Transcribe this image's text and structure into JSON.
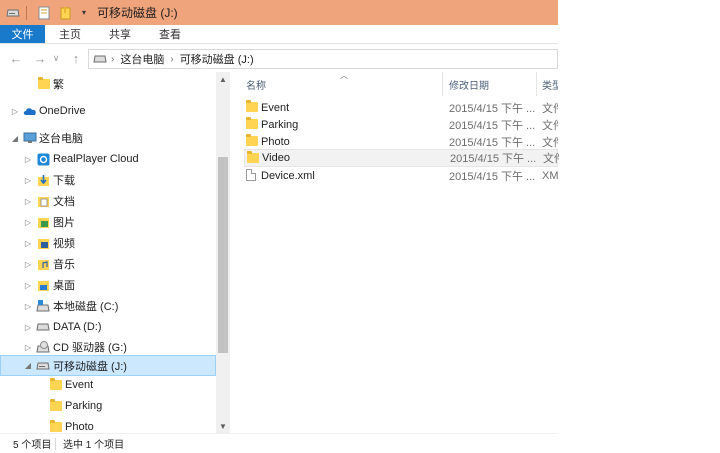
{
  "window": {
    "title": "可移动磁盘 (J:)"
  },
  "ribbon": {
    "tabs": [
      {
        "label": "文件"
      },
      {
        "label": "主页"
      },
      {
        "label": "共享"
      },
      {
        "label": "查看"
      }
    ]
  },
  "address": {
    "crumbs": [
      "这台电脑",
      "可移动磁盘 (J:)"
    ]
  },
  "nav": {
    "items": [
      {
        "label": "繁",
        "icon": "folder-icon"
      },
      {
        "label": "OneDrive",
        "icon": "onedrive-icon"
      },
      {
        "label": "这台电脑",
        "icon": "computer-icon"
      },
      {
        "label": "RealPlayer Cloud",
        "icon": "realplayer-cloud-icon"
      },
      {
        "label": "下载",
        "icon": "downloads-icon"
      },
      {
        "label": "文档",
        "icon": "documents-icon"
      },
      {
        "label": "图片",
        "icon": "pictures-icon"
      },
      {
        "label": "视频",
        "icon": "videos-icon"
      },
      {
        "label": "音乐",
        "icon": "music-icon"
      },
      {
        "label": "桌面",
        "icon": "desktop-icon"
      },
      {
        "label": "本地磁盘 (C:)",
        "icon": "local-disk-icon"
      },
      {
        "label": "DATA (D:)",
        "icon": "drive-icon"
      },
      {
        "label": "CD 驱动器 (G:)",
        "icon": "cd-drive-icon"
      },
      {
        "label": "可移动磁盘 (J:)",
        "icon": "removable-drive-icon"
      },
      {
        "label": "Event",
        "icon": "folder-icon"
      },
      {
        "label": "Parking",
        "icon": "folder-icon"
      },
      {
        "label": "Photo",
        "icon": "folder-icon"
      }
    ]
  },
  "columns": {
    "name": "名称",
    "date": "修改日期",
    "type": "类型"
  },
  "files": [
    {
      "name": "Event",
      "date": "2015/4/15 下午 ...",
      "type": "文件",
      "icon": "folder-icon"
    },
    {
      "name": "Parking",
      "date": "2015/4/15 下午 ...",
      "type": "文件",
      "icon": "folder-icon"
    },
    {
      "name": "Photo",
      "date": "2015/4/15 下午 ...",
      "type": "文件",
      "icon": "folder-icon"
    },
    {
      "name": "Video",
      "date": "2015/4/15 下午 ...",
      "type": "文件",
      "icon": "folder-icon"
    },
    {
      "name": "Device.xml",
      "date": "2015/4/15 下午 ...",
      "type": "XM",
      "icon": "document-icon"
    }
  ],
  "status": {
    "item_count": "5 个项目",
    "selected": "选中 1 个项目"
  },
  "colors": {
    "titlebar": "#f0a47c",
    "file_tab": "#1979ca",
    "selection": "#cce8ff",
    "folder": "#ffd453"
  }
}
